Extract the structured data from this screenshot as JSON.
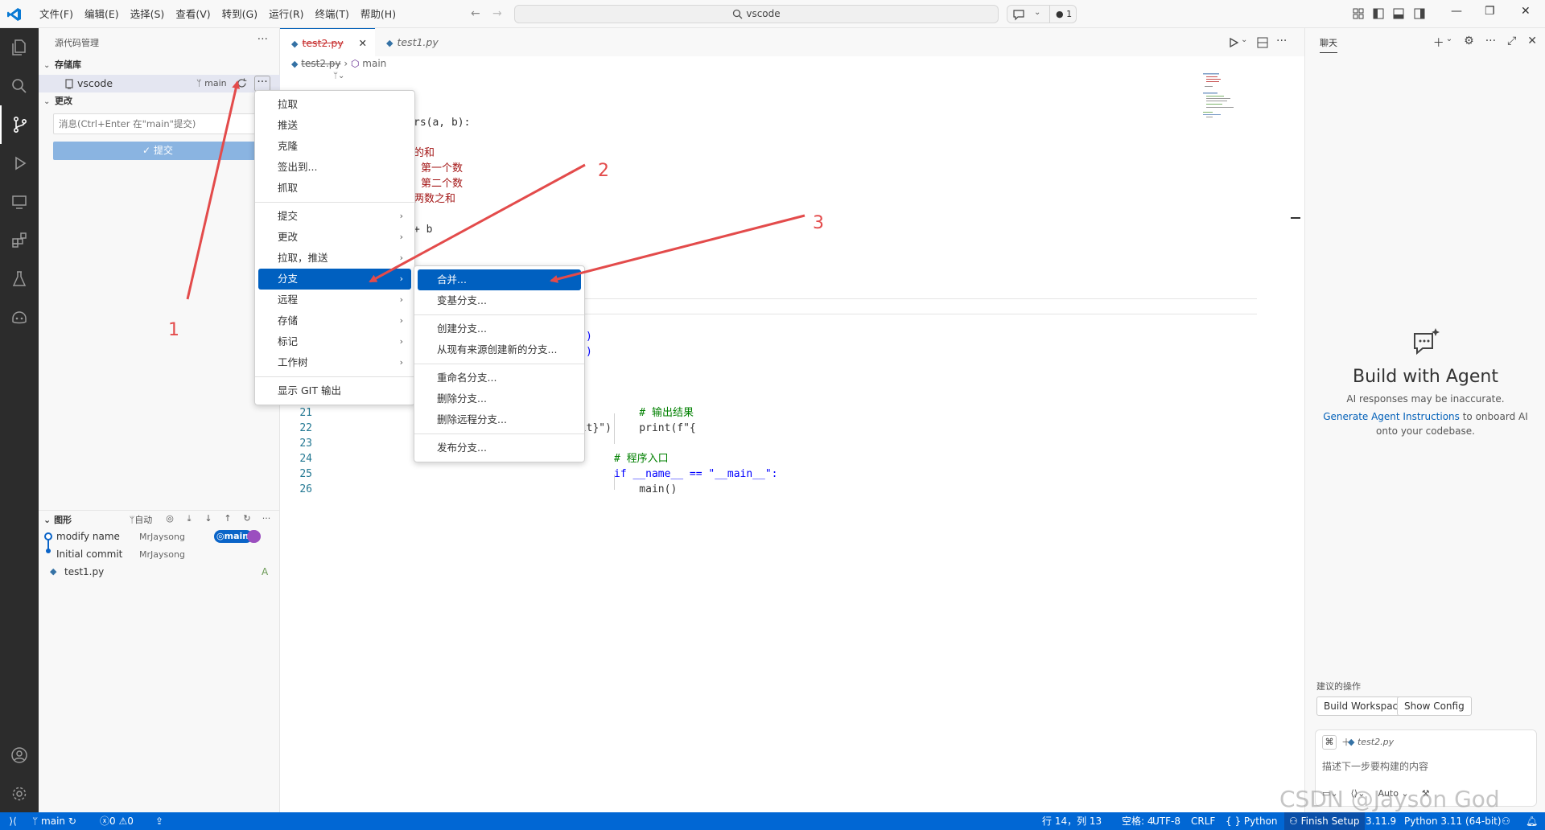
{
  "titlebar": {
    "menus": [
      "文件(F)",
      "编辑(E)",
      "选择(S)",
      "查看(V)",
      "转到(G)",
      "运行(R)",
      "终端(T)",
      "帮助(H)"
    ],
    "search_text": "vscode",
    "chat_count": "1"
  },
  "sidebar": {
    "title": "源代码管理",
    "repos_section": "存储库",
    "repo_name": "vscode",
    "repo_branch": "main",
    "changes_section": "更改",
    "commit_placeholder": "消息(Ctrl+Enter 在\"main\"提交)",
    "commit_button": "提交",
    "graph_section": "图形",
    "graph_auto": "自动",
    "graph": [
      {
        "title": "modify name",
        "author": "MrJaysong",
        "badge": "main"
      },
      {
        "title": "Initial commit",
        "author": "MrJaysong"
      }
    ],
    "file": {
      "name": "test1.py",
      "status": "A"
    }
  },
  "editor": {
    "tabs": [
      {
        "label": "test2.py",
        "active": true
      },
      {
        "label": "test1.py",
        "active": false
      }
    ],
    "breadcrumb_file": "test2.py",
    "breadcrumb_symbol": "main",
    "code_fragments": {
      "f1": "rs(a, b):",
      "f2": "的和",
      "f3": "第一个数",
      "f4": "第二个数",
      "f5": "两数之和",
      "f6": "+ b",
      "f7": ")",
      "f8": ")",
      "f9": "ult}\")"
    },
    "code_lines": [
      {
        "n": "21",
        "text": "    # 输出结果"
      },
      {
        "n": "22",
        "text": "    print(f\"{"
      },
      {
        "n": "23",
        "text": ""
      },
      {
        "n": "24",
        "text": "# 程序入口"
      },
      {
        "n": "25",
        "text": "if __name__ == \"__main__\":"
      },
      {
        "n": "26",
        "text": "    main()"
      }
    ]
  },
  "context_menu": {
    "items": [
      {
        "label": "拉取"
      },
      {
        "label": "推送"
      },
      {
        "label": "克隆"
      },
      {
        "label": "签出到..."
      },
      {
        "label": "抓取"
      },
      {
        "label": "提交",
        "submenu": true
      },
      {
        "label": "更改",
        "submenu": true
      },
      {
        "label": "拉取，推送",
        "submenu": true
      },
      {
        "label": "分支",
        "submenu": true,
        "highlight": true
      },
      {
        "label": "远程",
        "submenu": true
      },
      {
        "label": "存储",
        "submenu": true
      },
      {
        "label": "标记",
        "submenu": true
      },
      {
        "label": "工作树",
        "submenu": true
      },
      {
        "label": "显示 GIT 输出"
      }
    ]
  },
  "branch_submenu": {
    "items": [
      {
        "label": "合并...",
        "highlight": true
      },
      {
        "label": "变基分支..."
      },
      {
        "label": "创建分支..."
      },
      {
        "label": "从现有来源创建新的分支..."
      },
      {
        "label": "重命名分支..."
      },
      {
        "label": "删除分支..."
      },
      {
        "label": "删除远程分支..."
      },
      {
        "label": "发布分支..."
      }
    ]
  },
  "chat": {
    "title": "聊天",
    "heading": "Build with Agent",
    "disclaimer": "AI responses may be inaccurate.",
    "link": "Generate Agent Instructions",
    "link_suffix": " to onboard AI",
    "line2": "onto your codebase.",
    "suggest_label": "建议的操作",
    "suggestions": [
      "Build Workspace",
      "Show Config"
    ],
    "input_file": "test2.py",
    "input_placeholder": "描述下一步要构建的内容",
    "mode": "Auto"
  },
  "statusbar": {
    "branch": "main",
    "errors": "0",
    "warnings": "0",
    "position": "行 14，列 13",
    "spaces": "空格: 4",
    "encoding": "UTF-8",
    "eol": "CRLF",
    "language": "Python",
    "setup": "Finish Setup",
    "py_version": "3.11.9",
    "interpreter": "Python 3.11 (64-bit)"
  },
  "annotations": [
    "1",
    "2",
    "3"
  ],
  "watermark": "CSDN @Jayson God",
  "colors": {
    "accent": "#005fb8",
    "statusbar": "#0167d4",
    "arrow": "#e34b4b",
    "highlight": "#0060c0"
  }
}
